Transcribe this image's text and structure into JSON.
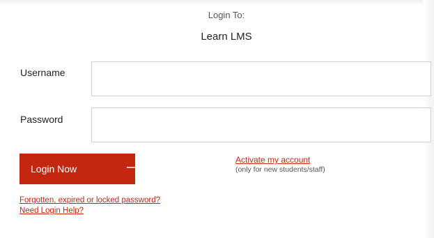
{
  "header": {
    "login_to": "Login To:",
    "site_name": "Learn LMS"
  },
  "form": {
    "username_label": "Username",
    "username_value": "",
    "username_placeholder": "",
    "password_label": "Password",
    "password_value": "",
    "password_placeholder": "",
    "login_button_label": "Login Now",
    "login_button_icon": "arrow-right-icon"
  },
  "activation": {
    "link_label": "Activate my account",
    "note": "(only for new students/staff)"
  },
  "help": {
    "forgot_label": "Forgotten, expired or locked password?",
    "login_help_label": "Need Login Help?"
  },
  "colors": {
    "accent": "#c4270f",
    "input_border": "#cfcfcf",
    "text": "#222222"
  }
}
